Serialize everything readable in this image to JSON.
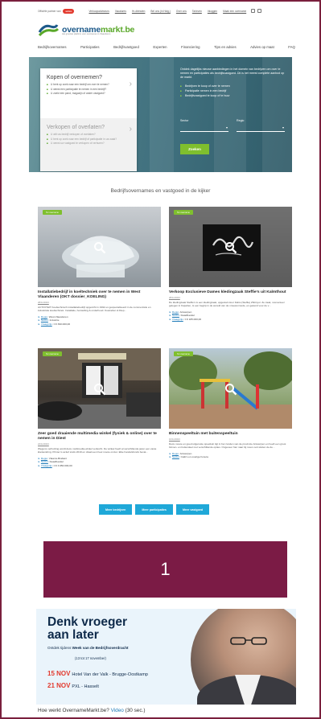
{
  "topbar": {
    "partner_text": "Officiële partner van",
    "partner_logo": "unizo",
    "links": [
      "Verkoopadviseurs",
      "Vacatures",
      "Hr-diensten",
      "Bel ons (in Holg.)",
      "Over ons",
      "Tarieven",
      "Inloggen",
      "Maak een overname"
    ],
    "icons": [
      "facebook-icon",
      "linkedin-icon"
    ]
  },
  "logo": {
    "name_part1": "overname",
    "name_part2": "markt.be",
    "tagline": "Het grootste platform voor overnames in Vlaanderen"
  },
  "nav": [
    "Bedrijfsovernames",
    "Participaties",
    "Bedrijfsvastgoed",
    "Experten",
    "Financiering",
    "Tips en advies",
    "Advies op maat",
    "FAQ"
  ],
  "hero": {
    "buy_title": "Kopen of overnemen?",
    "buy_items": [
      "U bent op zoek naar een bedrijf om over te nemen?",
      "U wenst een participatie te nemen in een bedrijf?",
      "U zoekt een pand, magazijn of ander vastgoed?"
    ],
    "sell_title": "Verkopen of overlaten?",
    "sell_items": [
      "U wilt uw bedrijf verkopen of overlaten?",
      "U bent op zoek naar een bedrijf of participatie in uw zaak?",
      "U wenst uw vastgoed te verkopen of verhuren?"
    ],
    "intro": "Ontdek dagelijks nieuwe aanbiedingen in het domein van bedrijven om over te nemen en participaties als bedrijfsvastgoed. Dit is het meest complete aanbod op de markt.",
    "bullets": [
      "Bedrijven te koop of over te nemen",
      "Participatie nemen in een bedrijf",
      "Bedrijfsvastgoed te koop of te huur"
    ],
    "field1_label": "Sector",
    "field2_label": "Regio",
    "submit_label": "Zoeken"
  },
  "section_title": "Bedrijfsovernames en vastgoed in de kijker",
  "listings": [
    {
      "badge": "Ter overname",
      "title": "Installatiebedrijf in koeltechniek over te nemen in West Vlaanderen (OKT dossier_KOELING)",
      "date": "28/11/2023",
      "desc": "ACTIVITEIT Koeltechnisch installatiebedrijf opgericht in 1992 en gespecialiseerd in de commerciële en industriële koeltechniek. Installatie, herstelling & onderhoud. Koelcellen & Diep...",
      "region_label": "Regio",
      "region": "West-Vlaanderen",
      "sector_label": "Sector",
      "sector": "Industrie",
      "price_label": "Vraagprijs",
      "price": "± € 390.000,00"
    },
    {
      "badge": "Ter overname",
      "title": "Verkoop Exclusieve Dames kledingzaak Steffie's uit Kalmthout",
      "date": "28/11/2023",
      "desc": "De kledingzaak Steffie's is een kledingzaak, opgestart door Fabio (Steffie) Zhitinyur. Ze zaak, momenteel gelegen in Kapellen, is een begrip in de wereld van de vrouwenmode, en gekend voor de v...",
      "region_label": "Regio",
      "region": "Antwerpen",
      "sector_label": "Sector",
      "sector": "Detailhandel",
      "price_label": "Vraagprijs",
      "price": "± € 185.000,00"
    },
    {
      "badge": "Ter overname",
      "title": "Zeer goed draaiende multimedia winkel (fysiek & online) over te nemen in Diest",
      "date": "22/11/2023",
      "desc": "Wegens verhuizing wordt deze multimedia-winkel verkocht. De winkel heeft al verschillende jaren een vaste klantenkring. Printer is actief sinds 2019 en draait een heel mooie omzet. Elke handelsfonds bevat...",
      "region_label": "Regio",
      "region": "Vlaams-Brabant",
      "sector_label": "Sector",
      "sector": "Detailhandel",
      "price_label": "Vraagprijs",
      "price": "± € 3.950.000,00"
    },
    {
      "badge": "Ter overname",
      "title": "Binnenspeeltuin met buitenspeeltuin",
      "date": "16/11/2023",
      "desc": "Deze mooie en goed uitgeruste speeltuin ligt in het zonden van de provincie Antwerpen en heeft een groot binnen- en buitendeel met verschillende opties. Ongeveer hier naar bij moon ooit sluiten de de...",
      "region_label": "Regio",
      "region": "Antwerpen",
      "sector_label": "Sector",
      "sector": "Café's en overige horeca",
      "price_label": "",
      "price": ""
    }
  ],
  "buttons": [
    "Meer bedrijven",
    "Meer participaties",
    "Meer vastgoed"
  ],
  "counter": "1",
  "banner": {
    "headline_line1": "Denk vroeger",
    "headline_line2": "aan later",
    "sub_prefix": "Ontdek tijdens ",
    "sub_bold": "Week van de Bedrijfsoverdracht",
    "dates": "(13 tot 17 november)",
    "event1_date": "15 NOV",
    "event1_place": "Hotel Van der Valk - Brugge-Oostkamp",
    "event2_date": "21 NOV",
    "event2_place": "PXL - Hasselt"
  },
  "howto": {
    "question": "Hoe werkt OvernameMarkt.be?",
    "video_label": "Video",
    "duration": "(30 sec.)"
  },
  "colors": {
    "accent_green": "#7fbf2e",
    "link_blue": "#1d7ab8",
    "button_blue": "#1fa8d8",
    "maroon": "#7b1b45"
  }
}
